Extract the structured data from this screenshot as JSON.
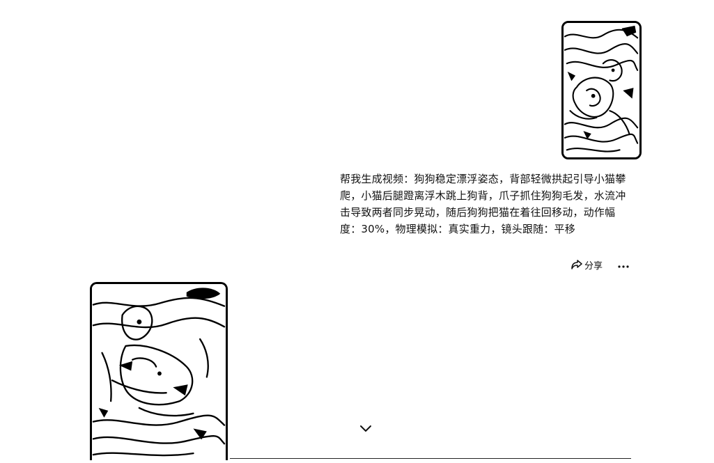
{
  "conversation": {
    "user_message": {
      "image_alt": "user-uploaded-dog-cat-water-sketch",
      "prompt": "帮我生成视频：狗狗稳定漂浮姿态，背部轻微拱起引导小猫攀爬，小猫后腿蹬离浮木跳上狗背，爪子抓住狗狗毛发，水流冲击导致两者同步晃动，随后狗狗把猫在着往回移动，动作幅度：30%，物理模拟：真实重力，镜头跟随：平移"
    },
    "message_actions": {
      "share_label": "分享",
      "share_icon": "share-arrow-icon",
      "more_icon": "ellipsis-icon"
    },
    "assistant_result": {
      "image_alt": "generated-video-preview-dog-carrying-cat"
    },
    "scroll_icon": "chevron-down-icon"
  }
}
